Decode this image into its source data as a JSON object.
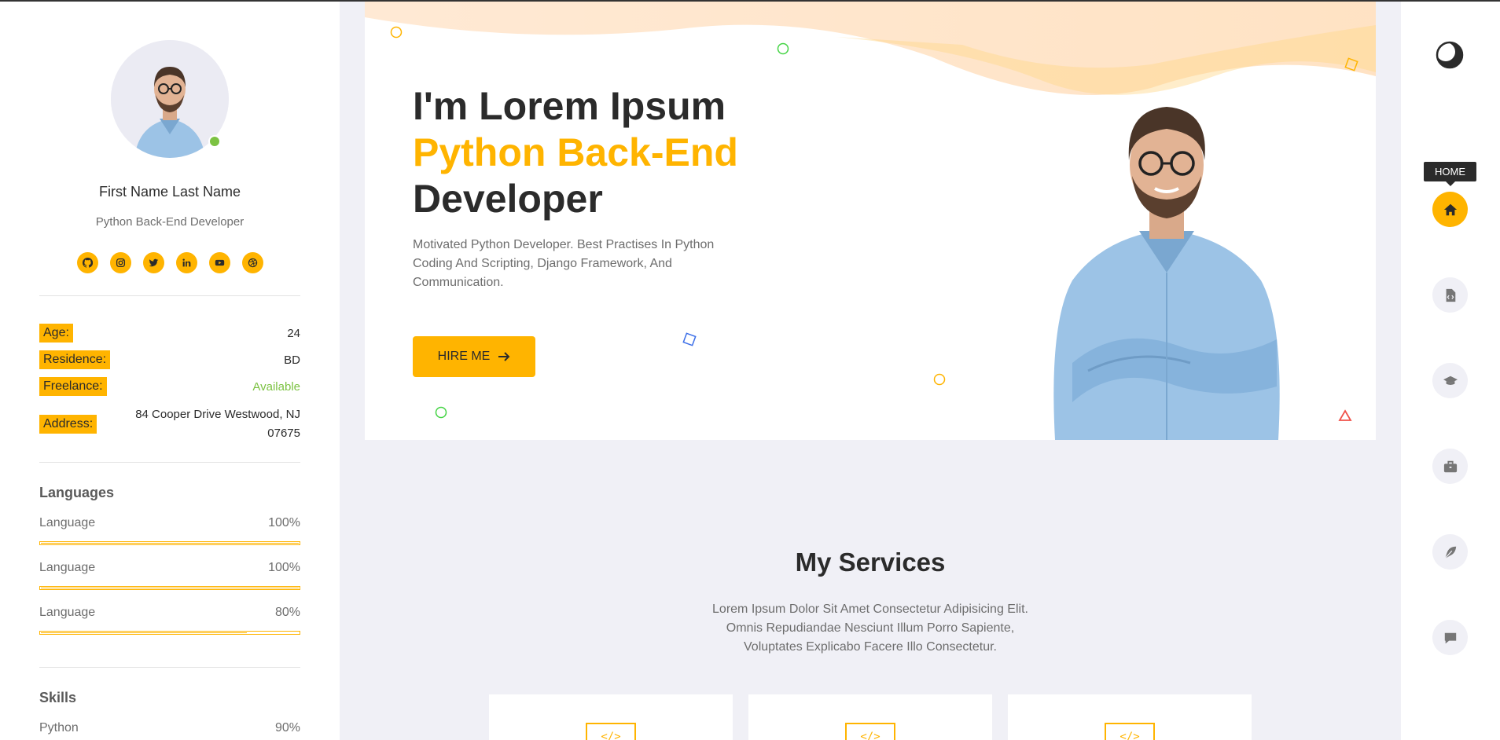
{
  "profile": {
    "name": "First Name Last Name",
    "role": "Python Back-End Developer",
    "online_color": "#7cc242",
    "socials": [
      {
        "icon": "github-icon"
      },
      {
        "icon": "instagram-icon"
      },
      {
        "icon": "twitter-icon"
      },
      {
        "icon": "linkedin-icon"
      },
      {
        "icon": "youtube-icon"
      },
      {
        "icon": "dribbble-icon"
      }
    ]
  },
  "info": {
    "age_label": "Age:",
    "age_value": "24",
    "residence_label": "Residence:",
    "residence_value": "BD",
    "freelance_label": "Freelance:",
    "freelance_value": "Available",
    "address_label": "Address:",
    "address_value_line1": "84 Cooper Drive Westwood, NJ",
    "address_value_line2": "07675"
  },
  "languages": {
    "title": "Languages",
    "items": [
      {
        "label": "Language",
        "value": "100%",
        "level": 1.0
      },
      {
        "label": "Language",
        "value": "100%",
        "level": 1.0
      },
      {
        "label": "Language",
        "value": "80%",
        "level": 0.8
      }
    ]
  },
  "skills": {
    "title": "Skills",
    "items": [
      {
        "label": "Python",
        "value": "90%",
        "level": 0.9
      }
    ]
  },
  "hero": {
    "line1": "I'm Lorem Ipsum",
    "line2": "Python Back-End",
    "line3": "Developer",
    "description": "Motivated Python Developer. Best Practises In Python Coding And Scripting, Django Framework, And Communication.",
    "button_label": "HIRE ME"
  },
  "services": {
    "title": "My Services",
    "description_line1": "Lorem Ipsum Dolor Sit Amet Consectetur Adipisicing Elit.",
    "description_line2": "Omnis Repudiandae Nesciunt Illum Porro Sapiente,",
    "description_line3": "Voluptates Explicabo Facere Illo Consectetur.",
    "card_icon": "code-icon",
    "card_icon_glyph": "</>"
  },
  "nav": {
    "tooltip": "HOME",
    "items": [
      {
        "icon": "home-icon",
        "active": true
      },
      {
        "icon": "code-file-icon",
        "active": false
      },
      {
        "icon": "graduation-cap-icon",
        "active": false
      },
      {
        "icon": "briefcase-icon",
        "active": false
      },
      {
        "icon": "feather-icon",
        "active": false
      },
      {
        "icon": "comment-icon",
        "active": false
      }
    ],
    "theme_icon": "moon-icon"
  },
  "colors": {
    "accent": "#ffb400",
    "available": "#7cc242",
    "background": "#f0f0f6"
  }
}
